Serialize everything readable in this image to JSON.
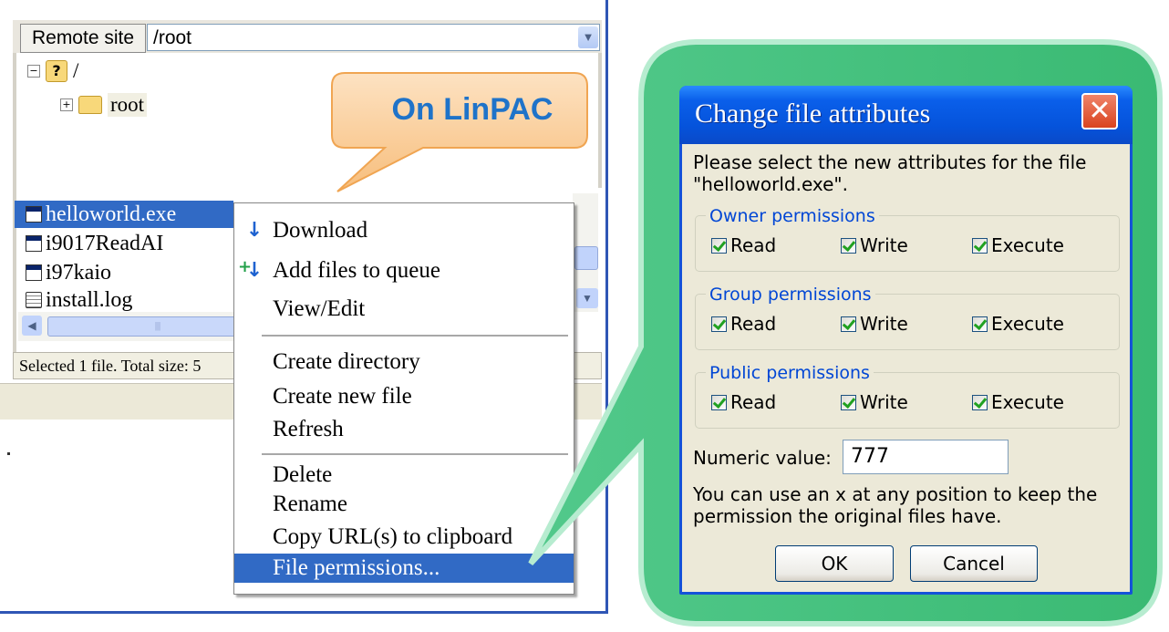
{
  "remote_site": {
    "label": "Remote site",
    "path": "/root"
  },
  "tree": {
    "root_label": "/",
    "child_label": "root"
  },
  "files": [
    {
      "name": "helloworld.exe",
      "icon": "exe-file-icon",
      "selected": true
    },
    {
      "name": "i9017ReadAI",
      "icon": "window-file-icon",
      "selected": false
    },
    {
      "name": "i97kaio",
      "icon": "window-file-icon",
      "selected": false
    },
    {
      "name": "install.log",
      "icon": "text-file-icon",
      "selected": false
    }
  ],
  "status_bar": "Selected 1 file. Total size: 5",
  "context_menu": {
    "download": "Download",
    "add_to_queue": "Add files to queue",
    "view_edit": "View/Edit",
    "create_directory": "Create directory",
    "create_new_file": "Create new file",
    "refresh": "Refresh",
    "delete": "Delete",
    "rename": "Rename",
    "copy_url": "Copy URL(s) to clipboard",
    "file_permissions": "File permissions..."
  },
  "callout": "On LinPAC",
  "dialog": {
    "title": "Change file attributes",
    "prompt_line1": "Please select the new attributes for the file",
    "prompt_line2": "\"helloworld.exe\".",
    "groups": [
      {
        "label": "Owner permissions",
        "read": "Read",
        "write": "Write",
        "execute": "Execute",
        "read_checked": true,
        "write_checked": true,
        "execute_checked": true
      },
      {
        "label": "Group permissions",
        "read": "Read",
        "write": "Write",
        "execute": "Execute",
        "read_checked": true,
        "write_checked": true,
        "execute_checked": true
      },
      {
        "label": "Public permissions",
        "read": "Read",
        "write": "Write",
        "execute": "Execute",
        "read_checked": true,
        "write_checked": true,
        "execute_checked": true
      }
    ],
    "numeric_label": "Numeric value:",
    "numeric_value": "777",
    "hint_line1": "You can use an x at any position to keep the",
    "hint_line2": "permission the original files have.",
    "ok": "OK",
    "cancel": "Cancel"
  },
  "colors": {
    "selection_blue": "#316ac5",
    "bubble_green": "#3dbb78",
    "callout_orange": "#f7be7c",
    "callout_text": "#1f73c9",
    "title_bar_blue": "#0553db"
  }
}
